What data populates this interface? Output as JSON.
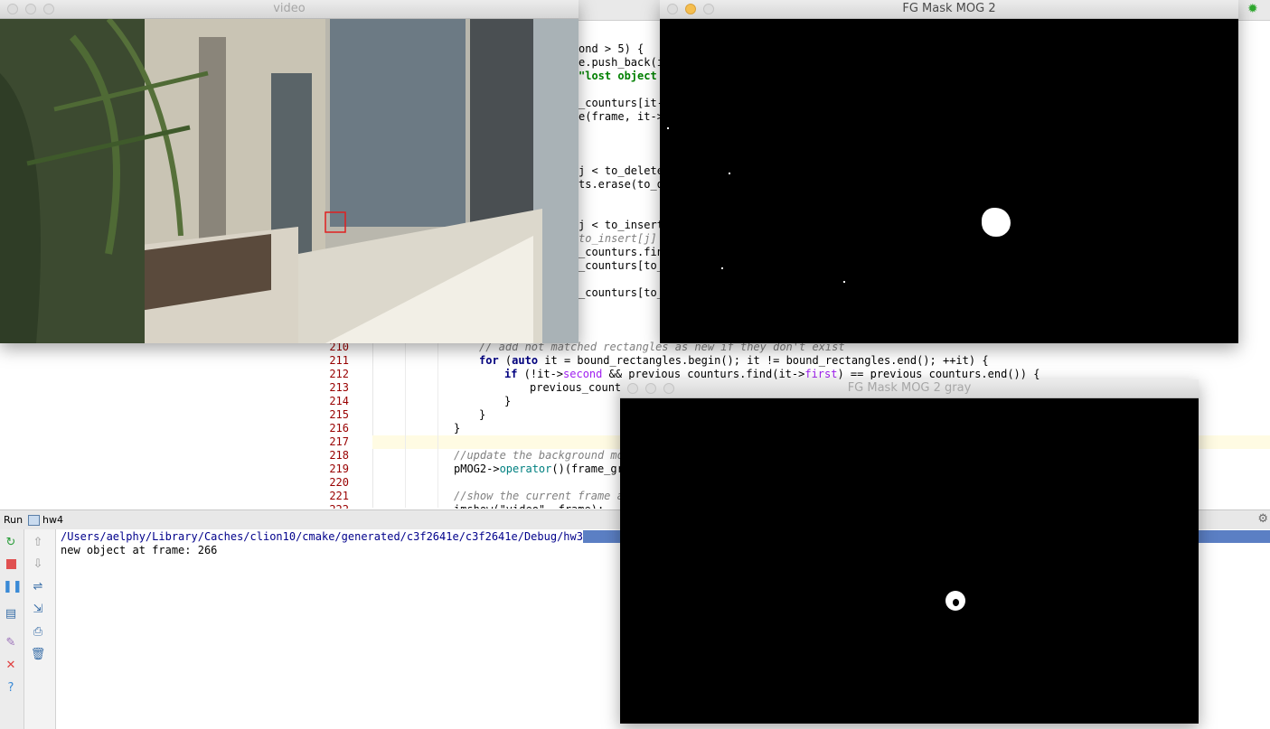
{
  "editor": {
    "line_numbers": [
      "210",
      "211",
      "212",
      "213",
      "214",
      "215",
      "216",
      "217",
      "218",
      "219",
      "220",
      "221",
      "222"
    ],
    "lines_above": [
      {
        "text": "ond > 5) {"
      },
      {
        "text": "e.push_back(i"
      },
      {
        "text": "\"lost object "
      },
      {
        "text": ""
      },
      {
        "text": "_counturs[it-"
      },
      {
        "text": "e(frame, it->"
      },
      {
        "text": ""
      },
      {
        "text": ""
      },
      {
        "text": "j < to_delete"
      },
      {
        "text": "ts.erase(to_d"
      },
      {
        "text": ""
      },
      {
        "text": ""
      },
      {
        "text": "j < to_insert"
      },
      {
        "text": "to_insert[j]"
      },
      {
        "text": "_counturs.fin"
      },
      {
        "text": "_counturs[to_"
      },
      {
        "text": ""
      },
      {
        "text": "_counturs[to_"
      }
    ],
    "code_210": "// add not matched rectangles as new if they don't exist",
    "code_211_a": "for",
    "code_211_b": " (",
    "code_211_c": "auto",
    "code_211_d": " it = bound_rectangles.begin(); it != bound_rectangles.end(); ++it) {",
    "code_212_a": "if",
    "code_212_b": " (!it->",
    "code_212_c": "second",
    "code_212_d": " && previous_counturs.find(it->",
    "code_212_e": "first",
    "code_212_f": ") == previous_counturs.end()) {",
    "code_213": "previous_countu",
    "code_214": "}",
    "code_215": "}",
    "code_216": "}",
    "code_218": "//update the background mo",
    "code_219_a": "pMOG2->",
    "code_219_b": "operator",
    "code_219_c": "()(frame_gr",
    "code_221": "//show the current frame a",
    "code_222": "imshow(\"video\", frame);"
  },
  "run_panel": {
    "label": "Run",
    "config": "hw4",
    "console_path": "/Users/aelphy/Library/Caches/clion10/cmake/generated/c3f2641e/c3f2641e/Debug/hw3",
    "console_output": "new object at frame: 266"
  },
  "windows": {
    "video_title": "video",
    "mog2_title": "FG Mask MOG 2",
    "mog2_gray_title": "FG Mask MOG 2 gray"
  },
  "colors": {
    "line_number": "#990000",
    "keyword": "#000080",
    "comment": "#808080",
    "selection": "#5b7fc4",
    "detection_box": "#e02020"
  }
}
